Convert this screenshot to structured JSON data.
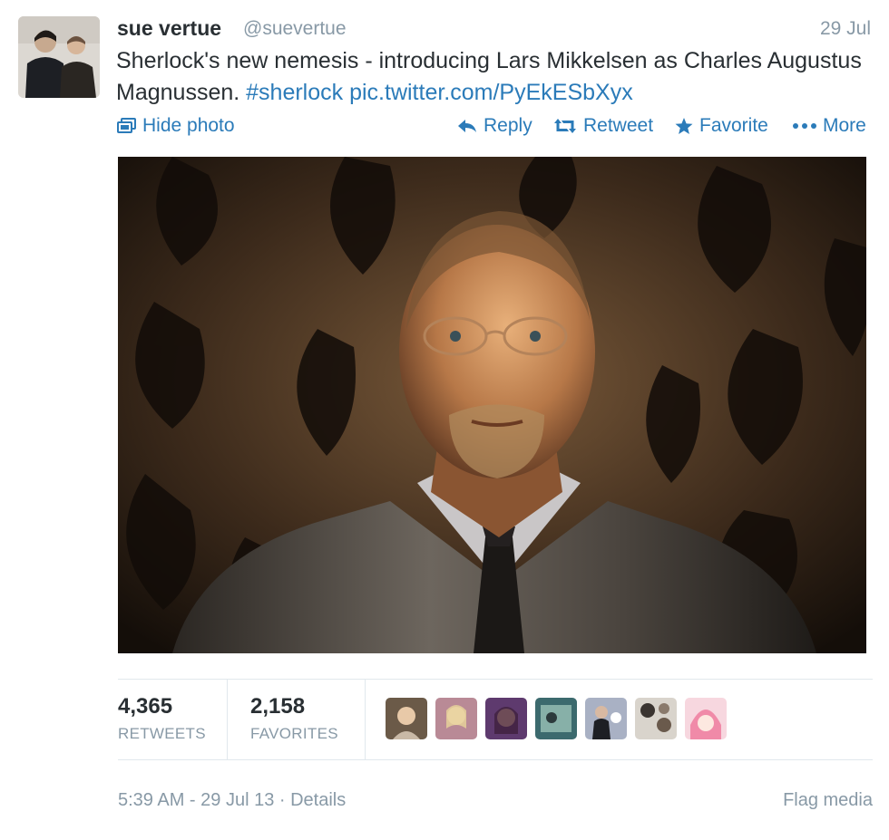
{
  "tweet": {
    "fullname": "sue vertue",
    "username": "@suevertue",
    "date": "29 Jul",
    "text_part1": "Sherlock's new nemesis - introducing Lars Mikkelsen as Charles Augustus Magnussen. ",
    "hashtag": "#sherlock",
    "media_link": "pic.twitter.com/PyEkESbXyx"
  },
  "actions": {
    "hide_photo": "Hide photo",
    "reply": "Reply",
    "retweet": "Retweet",
    "favorite": "Favorite",
    "more": "More"
  },
  "stats": {
    "retweets_count": "4,365",
    "retweets_label": "RETWEETS",
    "favorites_count": "2,158",
    "favorites_label": "FAVORITES"
  },
  "footer": {
    "timestamp": "5:39 AM - 29 Jul 13",
    "separator": " · ",
    "details": "Details",
    "flag_media": "Flag media"
  },
  "colors": {
    "link": "#2b7bb9",
    "muted": "#8899a6",
    "text": "#292f33",
    "divider": "#e1e8ed"
  },
  "icons": {
    "hide_photo": "photo-icon",
    "reply": "reply-arrow-icon",
    "retweet": "retweet-icon",
    "favorite": "star-icon",
    "more": "ellipsis-icon"
  }
}
